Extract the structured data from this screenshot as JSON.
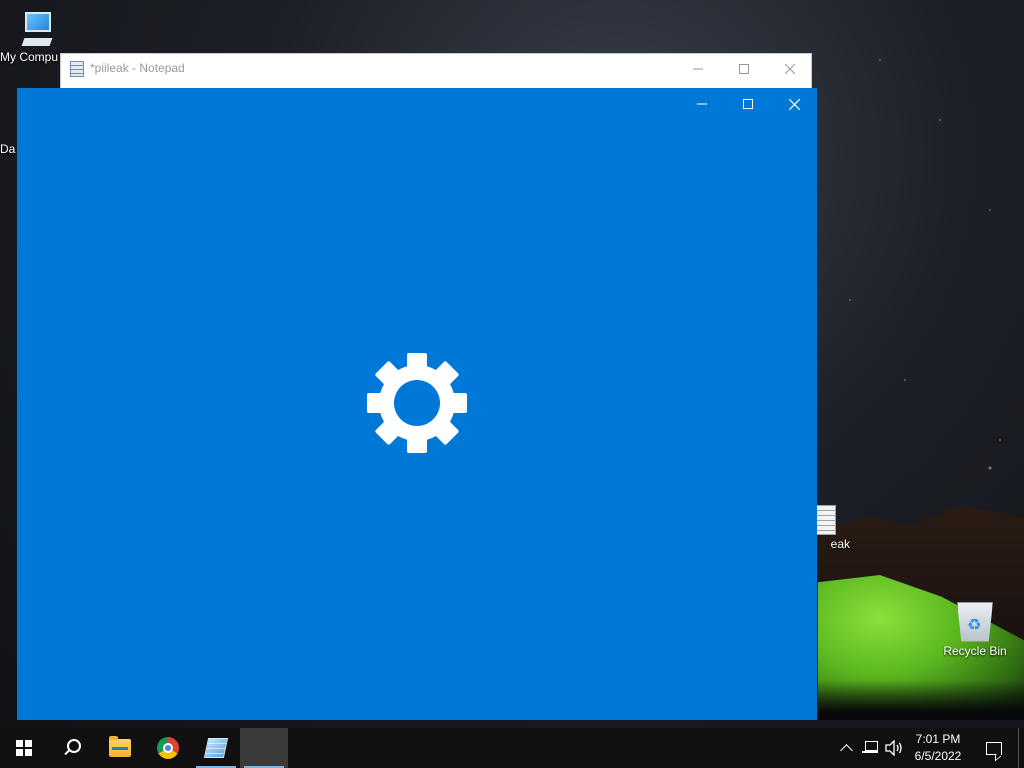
{
  "desktop": {
    "icons": [
      {
        "label": "My Compu"
      },
      {
        "label": "Da"
      },
      {
        "label": "eak"
      },
      {
        "label": "Recycle Bin"
      }
    ]
  },
  "notepad": {
    "title": "*piileak - Notepad"
  },
  "settings_window": {
    "state": "loading",
    "icon": "gear-icon",
    "accent_color": "#0078d7"
  },
  "taskbar": {
    "apps": [
      "start-icon",
      "search-icon",
      "file-explorer-icon",
      "chrome-icon",
      "notepad-icon",
      "settings-app"
    ],
    "clock_time": "7:01 PM",
    "clock_date": "6/5/2022"
  }
}
